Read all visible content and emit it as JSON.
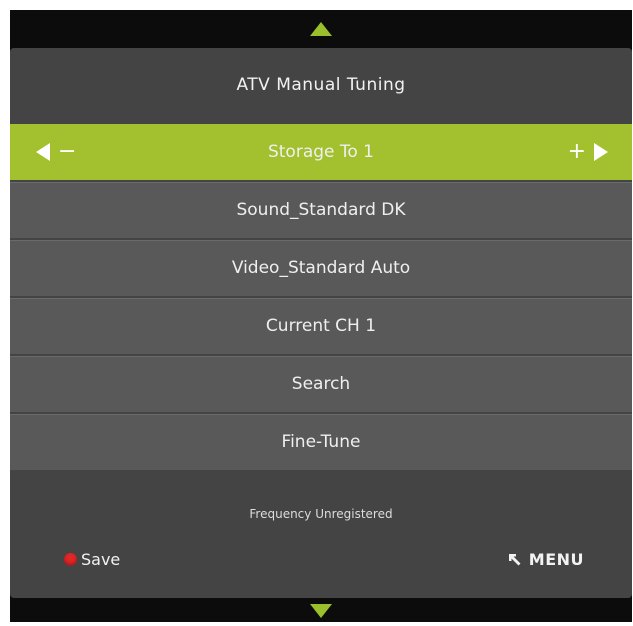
{
  "menu": {
    "title": "ATV Manual Tuning",
    "items": [
      {
        "label": "Storage To 1",
        "selected": true
      },
      {
        "label": "Sound_Standard DK",
        "selected": false
      },
      {
        "label": "Video_Standard Auto",
        "selected": false
      },
      {
        "label": "Current CH 1",
        "selected": false
      },
      {
        "label": "Search",
        "selected": false
      },
      {
        "label": "Fine-Tune",
        "selected": false
      }
    ],
    "status": "Frequency Unregistered",
    "minus_symbol": "−",
    "plus_symbol": "+"
  },
  "footer": {
    "save_label": "Save",
    "menu_label": "MENU"
  },
  "colors": {
    "accent": "#a3c12e",
    "panel": "#444444",
    "row": "#595959",
    "save_dot": "#e02626"
  },
  "icons": {
    "scroll_up": "triangle-up-icon",
    "scroll_down": "triangle-down-icon",
    "decrease": "left-triangle-icon",
    "increase": "right-triangle-icon",
    "save": "red-circle-icon",
    "menu": "return-arrow-icon"
  }
}
